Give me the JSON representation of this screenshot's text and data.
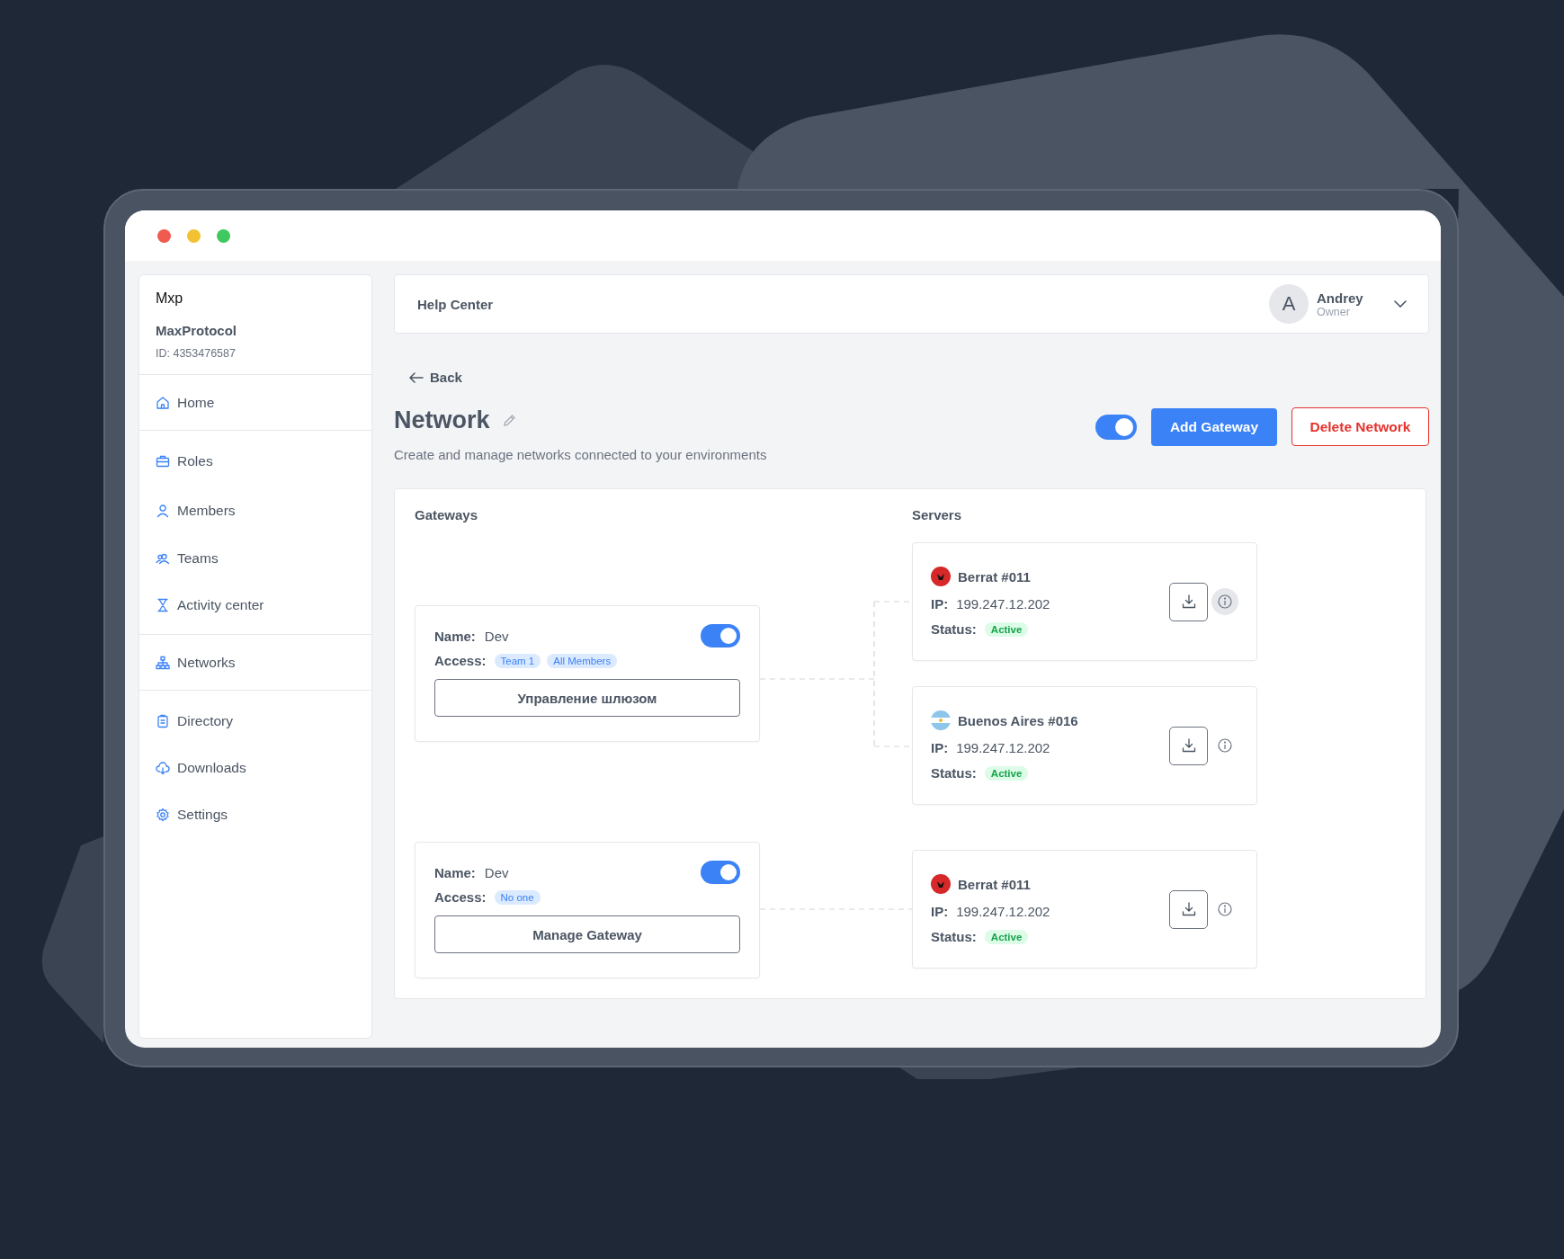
{
  "brand": {
    "logo": "Mxp",
    "name": "MaxProtocol",
    "id": "ID: 4353476587"
  },
  "sidebar": {
    "sections": [
      {
        "items": [
          {
            "label": "Home"
          }
        ]
      },
      {
        "items": [
          {
            "label": "Roles"
          },
          {
            "label": "Members"
          },
          {
            "label": "Teams"
          },
          {
            "label": "Activity center"
          }
        ]
      },
      {
        "items": [
          {
            "label": "Networks"
          }
        ]
      },
      {
        "items": [
          {
            "label": "Directory"
          },
          {
            "label": "Downloads"
          },
          {
            "label": "Settings"
          }
        ]
      }
    ]
  },
  "header": {
    "link": "Help Center",
    "user": {
      "initial": "A",
      "name": "Andrey",
      "role": "Owner"
    }
  },
  "back": "Back",
  "page": {
    "title": "Network",
    "subtitle": "Create and manage networks connected to your environments",
    "enabled": true,
    "buttons": [
      "Add Gateway",
      "Delete Network"
    ]
  },
  "gateways": {
    "title": "Gateways",
    "items": [
      {
        "name_label": "Name:",
        "name": "Dev",
        "on": true,
        "access_label": "Access:",
        "access": [
          "Team 1",
          "All Members"
        ],
        "button": "Управление шлюзом"
      },
      {
        "name_label": "Name:",
        "name": "Dev",
        "on": true,
        "access_label": "Access:",
        "access": [
          "No one"
        ],
        "button": "Manage Gateway"
      }
    ]
  },
  "servers": {
    "title": "Servers",
    "items": [
      {
        "name": "Berrat #011",
        "color": "#d62828",
        "ip_label": "IP:",
        "ip": "199.247.12.202",
        "status_label": "Status:",
        "status": "Active",
        "info_hovered": true
      },
      {
        "name": "Buenos Aires #016",
        "color": "#8ec5ea",
        "ip_label": "IP:",
        "ip": "199.247.12.202",
        "status_label": "Status:",
        "status": "Active",
        "info_hovered": false
      },
      {
        "name": "Berrat #011",
        "color": "#d62828",
        "ip_label": "IP:",
        "ip": "199.247.12.202",
        "status_label": "Status:",
        "status": "Active",
        "info_hovered": false
      }
    ]
  }
}
